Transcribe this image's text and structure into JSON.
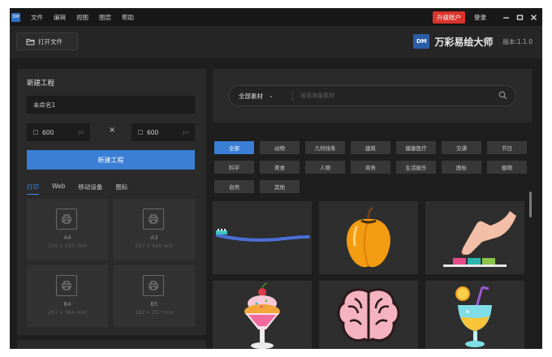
{
  "menubar": {
    "logo": "DM",
    "items": [
      "文件",
      "编辑",
      "视图",
      "图层",
      "帮助"
    ],
    "upgrade_label": "升级账户",
    "login_label": "登录",
    "window_controls": [
      "minimize",
      "maximize",
      "close"
    ]
  },
  "toolbar": {
    "open_file_label": "打开文件",
    "brand_logo": "DM",
    "brand_name": "万彩易绘大师",
    "version": "版本:1.1.0"
  },
  "new_project": {
    "title": "新建工程",
    "name_value": "未命名1",
    "width_value": "600",
    "height_value": "600",
    "unit": "px",
    "times_symbol": "×",
    "create_label": "新建工程",
    "tabs": [
      {
        "label": "打印",
        "active": true
      },
      {
        "label": "Web",
        "active": false
      },
      {
        "label": "移动设备",
        "active": false
      },
      {
        "label": "图标",
        "active": false
      }
    ],
    "presets": [
      {
        "name": "A4",
        "size": "210 x 297 mm"
      },
      {
        "name": "A3",
        "size": "297 x 420 mm"
      },
      {
        "name": "B4",
        "size": "257 x 364 mm"
      },
      {
        "name": "B5",
        "size": "182 x 257 mm"
      }
    ]
  },
  "search": {
    "category": "全部素材",
    "placeholder": "搜索海量素材"
  },
  "categories": [
    {
      "label": "全部",
      "active": true
    },
    {
      "label": "动物"
    },
    {
      "label": "几何线条"
    },
    {
      "label": "建筑"
    },
    {
      "label": "健康医疗"
    },
    {
      "label": "交通"
    },
    {
      "label": "节日"
    },
    {
      "label": "科学"
    },
    {
      "label": "美食"
    },
    {
      "label": "人物"
    },
    {
      "label": "商务"
    },
    {
      "label": "生活娱乐"
    },
    {
      "label": "图标"
    },
    {
      "label": "植物"
    },
    {
      "label": "自然"
    },
    {
      "label": "其他"
    }
  ],
  "assets": [
    "toothbrush",
    "bell-pepper",
    "hand-pressing-button",
    "ice-cream-sundae",
    "brain",
    "cocktail-drink"
  ],
  "colors": {
    "accent": "#3a7fd5",
    "upgrade": "#d9342b",
    "panel": "#2a2a2a",
    "background": "#1e1e1e"
  }
}
